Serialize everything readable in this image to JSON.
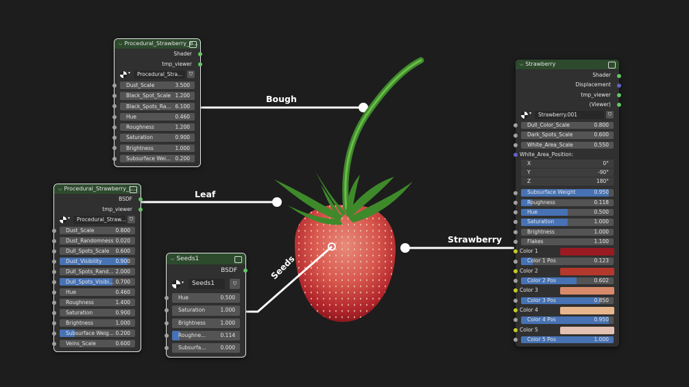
{
  "labels": {
    "bough": "Bough",
    "leaf": "Leaf",
    "seeds": "Seeds",
    "strawberry": "Strawberry"
  },
  "colors": {
    "header_green": "#2d4a2d",
    "field_blue": "#4772b3",
    "socket_green": "#63c763",
    "socket_grey": "#a1a1a1",
    "socket_yellow": "#c7c729",
    "socket_purple": "#6363c7"
  },
  "bough_node": {
    "title": "Procedural_Strawberry_B...",
    "outputs": [
      "Shader",
      "tmp_viewer"
    ],
    "datablock": "Procedural_Stra...",
    "inputs": [
      {
        "label": "Dust_Scale",
        "value": "3.500"
      },
      {
        "label": "Black_Spot_Scale",
        "value": "1.200"
      },
      {
        "label": "Black_Spots_Ra...",
        "value": "6.100"
      },
      {
        "label": "Hue",
        "value": "0.460"
      },
      {
        "label": "Roughness",
        "value": "1.200"
      },
      {
        "label": "Saturation",
        "value": "0.900"
      },
      {
        "label": "Brightness",
        "value": "1.000"
      },
      {
        "label": "Subsurface Wei...",
        "value": "0.200"
      }
    ]
  },
  "leaf_node": {
    "title": "Procedural_Strawberry_L...",
    "outputs": [
      "BSDF",
      "tmp_viewer"
    ],
    "datablock": "Procedural_Straw...",
    "inputs": [
      {
        "label": "Dust_Scale",
        "value": "0.800",
        "fill": 0
      },
      {
        "label": "Dust_Randomness",
        "value": "0.020",
        "fill": 0
      },
      {
        "label": "Dull_Spots_Scale",
        "value": "0.600",
        "fill": 0
      },
      {
        "label": "Dust_Visibility",
        "value": "0.900",
        "fill": 0.9
      },
      {
        "label": "Dull_Spots_Rand...",
        "value": "2.000",
        "fill": 0
      },
      {
        "label": "Dull_Spots_Visibi...",
        "value": "0.700",
        "fill": 0.7
      },
      {
        "label": "Hue",
        "value": "0.460",
        "fill": 0
      },
      {
        "label": "Roughness",
        "value": "1.400",
        "fill": 0
      },
      {
        "label": "Saturation",
        "value": "0.900",
        "fill": 0
      },
      {
        "label": "Brightness",
        "value": "1.000",
        "fill": 0
      },
      {
        "label": "Subsurface Weig...",
        "value": "0.200",
        "fill": 0.2
      },
      {
        "label": "Veins_Scale",
        "value": "0.600",
        "fill": 0
      }
    ]
  },
  "seeds_node": {
    "title": "Seeds1",
    "outputs": [
      "BSDF"
    ],
    "datablock": "Seeds1",
    "inputs": [
      {
        "label": "Hue",
        "value": "0.500",
        "fill": 0
      },
      {
        "label": "Saturation",
        "value": "1.000",
        "fill": 0
      },
      {
        "label": "Brightness",
        "value": "1.000",
        "fill": 0
      },
      {
        "label": "Roughne...",
        "value": "0.114",
        "fill": 0.114
      },
      {
        "label": "Subsurfa...",
        "value": "0.000",
        "fill": 0
      }
    ]
  },
  "strawberry_node": {
    "title": "Strawberry",
    "outputs": [
      "Shader",
      "Displacement",
      "tmp_viewer",
      "(Viewer)"
    ],
    "datablock": "Strawberry.001",
    "inputs": [
      {
        "label": "Dull_Color_Scale",
        "value": "0.800",
        "fill": 0
      },
      {
        "label": "Dark_Spots_Scale",
        "value": "0.600",
        "fill": 0
      },
      {
        "label": "White_Area_Scale",
        "value": "0.550",
        "fill": 0
      }
    ],
    "vector_label": "White_Area_Position:",
    "vector": [
      {
        "label": "X",
        "value": "0°"
      },
      {
        "label": "Y",
        "value": "-90°"
      },
      {
        "label": "Z",
        "value": "180°"
      }
    ],
    "inputs2": [
      {
        "label": "Subsurface Weight",
        "value": "0.950",
        "fill": 0.95
      },
      {
        "label": "Roughness",
        "value": "0.118",
        "fill": 0.118
      },
      {
        "label": "Hue",
        "value": "0.500",
        "fill": 0.5
      },
      {
        "label": "Saturation",
        "value": "1.000",
        "fill": 0.5
      },
      {
        "label": "Brightness",
        "value": "1.000",
        "fill": 0
      },
      {
        "label": "Flakes",
        "value": "1.100",
        "fill": 0
      }
    ],
    "colors": [
      {
        "label": "Color 1",
        "swatch": "#9a1a22",
        "pos_label": "Color 1 Pos",
        "pos": "0.123",
        "fill": 0.123
      },
      {
        "label": "Color 2",
        "swatch": "#b5382c",
        "pos_label": "Color 2 Pos",
        "pos": "0.602",
        "fill": 0.602
      },
      {
        "label": "Color 3",
        "swatch": "#d98a6a",
        "pos_label": "Color 3 Pos",
        "pos": "0.850",
        "fill": 0.85
      },
      {
        "label": "Color 4",
        "swatch": "#e8b68c",
        "pos_label": "Color 4 Pos",
        "pos": "0.950",
        "fill": 0.95
      },
      {
        "label": "Color 5",
        "swatch": "#e3c2b4",
        "pos_label": "Color 5 Pos",
        "pos": "1.000",
        "fill": 1.0
      }
    ]
  }
}
